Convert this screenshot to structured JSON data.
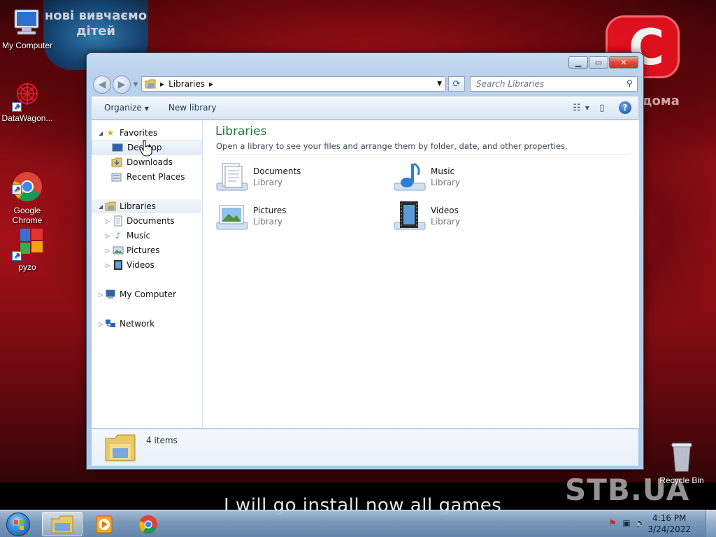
{
  "desktop": {
    "icons": [
      {
        "label": "My Computer"
      },
      {
        "label": "DataWagon..."
      },
      {
        "label": "Google\nChrome"
      },
      {
        "label": "pyzo"
      },
      {
        "label": "Recycle Bin"
      }
    ]
  },
  "wallpaper": {
    "logo_blue_text": "нові вивчаємо дітей",
    "logo_red_letter": "С",
    "side_text": "дома",
    "watermark": "STB.UA",
    "subtitle": "I will go install now all games"
  },
  "window": {
    "address": {
      "location": "Libraries"
    },
    "search": {
      "placeholder": "Search Libraries"
    },
    "commands": {
      "organize": "Organize",
      "new_library": "New library"
    },
    "nav": {
      "favorites": "Favorites",
      "desktop": "Desktop",
      "downloads": "Downloads",
      "recent_places": "Recent Places",
      "libraries": "Libraries",
      "documents": "Documents",
      "music": "Music",
      "pictures": "Pictures",
      "videos": "Videos",
      "my_computer": "My Computer",
      "network": "Network"
    },
    "content": {
      "title": "Libraries",
      "subtitle": "Open a library to see your files and arrange them by folder, date, and other properties.",
      "libraries": [
        {
          "name": "Documents",
          "type": "Library"
        },
        {
          "name": "Music",
          "type": "Library"
        },
        {
          "name": "Pictures",
          "type": "Library"
        },
        {
          "name": "Videos",
          "type": "Library"
        }
      ]
    },
    "details": {
      "count": "4 items"
    }
  },
  "taskbar": {
    "time": "4:16 PM",
    "date": "3/24/2022"
  }
}
